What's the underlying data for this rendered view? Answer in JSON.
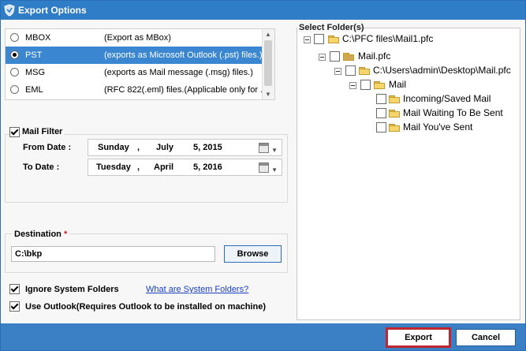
{
  "window": {
    "title": "Export Options"
  },
  "formats": [
    {
      "name": "MBOX",
      "description": "(Export as MBox)",
      "selected": false
    },
    {
      "name": "PST",
      "description": "(exports as Microsoft Outlook (.pst) files.)",
      "selected": true
    },
    {
      "name": "MSG",
      "description": "(exports as Mail message (.msg) files.)",
      "selected": false
    },
    {
      "name": "EML",
      "description": "(RFC 822(.eml) files.(Applicable only for ...",
      "selected": false
    }
  ],
  "mail_filter": {
    "label": "Mail Filter",
    "checked": true,
    "from_label": "From Date :",
    "from": {
      "weekday": "Sunday",
      "sep": ",",
      "month": "July",
      "dayyear": "5, 2015"
    },
    "to_label": "To Date :",
    "to": {
      "weekday": "Tuesday",
      "sep": ",",
      "month": "April",
      "dayyear": "5, 2016"
    }
  },
  "destination": {
    "label": "Destination",
    "required_mark": "*",
    "value": "C:\\bkp",
    "browse_label": "Browse"
  },
  "options": {
    "ignore_label": "Ignore System Folders",
    "ignore_checked": true,
    "system_link": "What are System Folders?",
    "outlook_label": "Use Outlook(Requires Outlook to be installed on machine)",
    "outlook_checked": true
  },
  "tree": {
    "label": "Select Folder(s)",
    "nodes": [
      {
        "label": "C:\\PFC files\\Mail1.pfc"
      },
      {
        "label": "Mail.pfc"
      },
      {
        "label": "C:\\Users\\admin\\Desktop\\Mail.pfc"
      },
      {
        "label": "Mail"
      },
      {
        "label": "Incoming/Saved Mail"
      },
      {
        "label": "Mail Waiting To Be Sent"
      },
      {
        "label": "Mail You've Sent"
      }
    ]
  },
  "footer": {
    "export_label": "Export",
    "cancel_label": "Cancel"
  },
  "colors": {
    "titlebar": "#2f7cc7",
    "footer": "#3b7fc4",
    "selection": "#3b86d0",
    "export_border": "#c0262d"
  }
}
